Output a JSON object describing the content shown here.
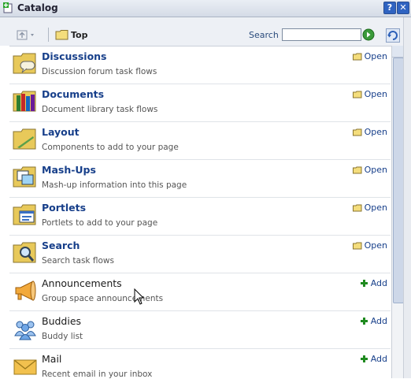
{
  "window": {
    "title": "Catalog",
    "help_glyph": "?",
    "close_glyph": "✕"
  },
  "toolbar": {
    "up_icon": "up-folder-icon",
    "breadcrumb": "Top",
    "search_label": "Search",
    "search_value": "",
    "search_placeholder": ""
  },
  "items": [
    {
      "name": "Discussions",
      "description": "Discussion forum task flows",
      "action": "Open",
      "kind": "folder",
      "icon": "discussion-folder-icon"
    },
    {
      "name": "Documents",
      "description": "Document library task flows",
      "action": "Open",
      "kind": "folder",
      "icon": "documents-folder-icon"
    },
    {
      "name": "Layout",
      "description": "Components to add to your page",
      "action": "Open",
      "kind": "folder",
      "icon": "layout-folder-icon"
    },
    {
      "name": "Mash-Ups",
      "description": "Mash-up information into this page",
      "action": "Open",
      "kind": "folder",
      "icon": "mashups-folder-icon"
    },
    {
      "name": "Portlets",
      "description": "Portlets to add to your page",
      "action": "Open",
      "kind": "folder",
      "icon": "portlets-folder-icon"
    },
    {
      "name": "Search",
      "description": "Search task flows",
      "action": "Open",
      "kind": "folder",
      "icon": "search-folder-icon"
    },
    {
      "name": "Announcements",
      "description": "Group space announcements",
      "action": "Add",
      "kind": "item",
      "icon": "megaphone-icon"
    },
    {
      "name": "Buddies",
      "description": "Buddy list",
      "action": "Add",
      "kind": "item",
      "icon": "buddies-icon"
    },
    {
      "name": "Mail",
      "description": "Recent email in your inbox",
      "action": "Add",
      "kind": "item",
      "icon": "mail-icon"
    }
  ],
  "colors": {
    "folder_link": "#173f8a",
    "add_green": "#1f8a1f",
    "folder_yellow": "#e8c95a"
  }
}
